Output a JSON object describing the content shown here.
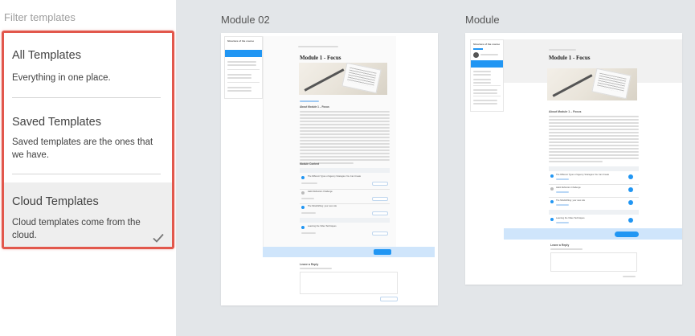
{
  "sidebar": {
    "header": "Filter templates",
    "items": [
      {
        "title": "All Templates",
        "description": "Everything in one place."
      },
      {
        "title": "Saved Templates",
        "description": "Saved templates are the ones that we have."
      },
      {
        "title": "Cloud Templates",
        "description": "Cloud templates come from the cloud."
      }
    ],
    "selected_icon": "check-icon"
  },
  "templates": [
    {
      "name": "Module 02",
      "preview": {
        "sidebar_title": "Structure of the course",
        "heading": "Module 1 - Focus",
        "about": "About Module 1 – Focus",
        "contents_title": "Module Content",
        "lesson_labels": [
          "The Different Types of Agency Strategies You Can Create",
          "Habit Reflection Challenge",
          "The Mindshifting: your new role",
          "Learning the Video Techniques"
        ],
        "reply_title": "Leave a Reply"
      }
    },
    {
      "name": "Module",
      "preview": {
        "sidebar_title": "Structure of the course",
        "heading": "Module 1 - Focus",
        "about": "About Module 1 – Focus",
        "lesson_labels": [
          "The Different Types of Agency Strategies You Can Create",
          "Habit Reflection Challenge",
          "The Mindshifting: your new role",
          "Learning the Video Techniques"
        ],
        "reply_title": "Leave a Reply"
      }
    }
  ],
  "colors": {
    "highlight_border": "#e2574c",
    "selected_bg": "#eeeeee",
    "gallery_bg": "#e3e6e9",
    "accent": "#2196f3"
  }
}
